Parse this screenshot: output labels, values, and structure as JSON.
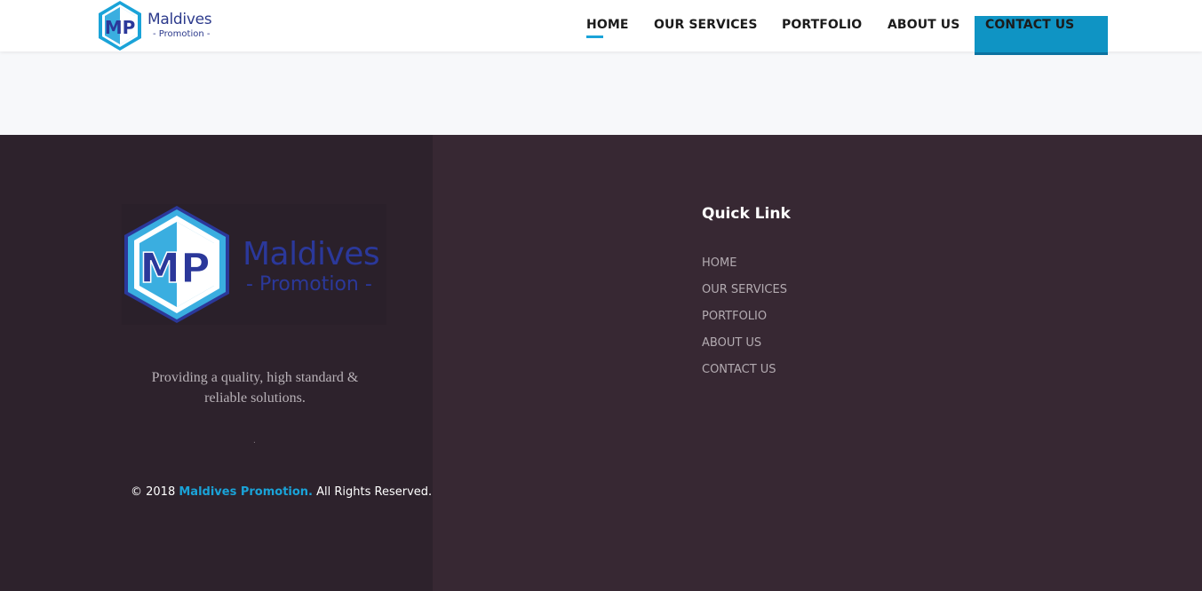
{
  "header": {
    "logo": {
      "monogram": "MP",
      "name": "Maldives",
      "sub": "Promotion"
    },
    "nav": [
      {
        "label": "HOME",
        "active": true
      },
      {
        "label": "OUR SERVICES"
      },
      {
        "label": "PORTFOLIO"
      },
      {
        "label": "ABOUT US"
      },
      {
        "label": "CONTACT US"
      }
    ],
    "menu_icon": "hamburger-icon"
  },
  "footer": {
    "logo": {
      "monogram": "MP",
      "name": "Maldives",
      "sub": "Promotion"
    },
    "tagline_line1": "Providing a quality, high standard &",
    "tagline_line2": "reliable solutions.",
    "dot": ".",
    "copyright_prefix": "© 2018",
    "copyright_brand": "Maldives Promotion.",
    "copyright_suffix": "All Rights Reserved.",
    "quick_link_title": "Quick Link",
    "quick_links": [
      "HOME",
      "OUR SERVICES",
      "PORTFOLIO",
      "ABOUT US",
      "CONTACT US"
    ]
  },
  "colors": {
    "accent": "#1aa3d8",
    "brand_blue": "#2b389a",
    "footer_bg": "#372833",
    "footer_left_bg": "#2d222c"
  }
}
